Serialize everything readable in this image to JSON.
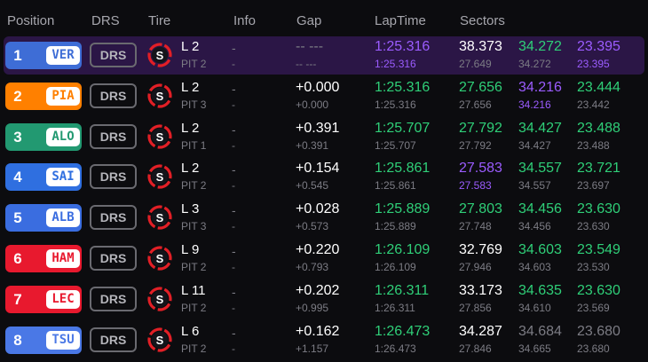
{
  "colors": {
    "purple": "#9b5cff",
    "green": "#2fcf78",
    "white": "#ffffff",
    "grey": "#7c7c84",
    "highlight_row": "#2b1646"
  },
  "header": {
    "position": "Position",
    "drs": "DRS",
    "tire": "Tire",
    "info": "Info",
    "gap": "Gap",
    "laptime": "LapTime",
    "sectors": "Sectors"
  },
  "rows": [
    {
      "pos": "1",
      "code": "VER",
      "team_color": "#3e6dd6",
      "drs": "DRS",
      "tire_icon": "soft-tire-icon",
      "tire_letter": "S",
      "lap": "L 2",
      "pit": "PIT 2",
      "info1": "-",
      "info2": "-",
      "gap": "-- ---",
      "gap_sub": "-- ---",
      "laptime": "1:25.316",
      "laptime_color": "#9b5cff",
      "laptime_sub": "1:25.316",
      "laptime_sub_color": "#9b5cff",
      "s1": "38.373",
      "s1_color": "#ffffff",
      "s1_sub": "27.649",
      "s1_sub_color": "#7c7c84",
      "s2": "34.272",
      "s2_color": "#2fcf78",
      "s2_sub": "34.272",
      "s2_sub_color": "#7c7c84",
      "s3": "23.395",
      "s3_color": "#9b5cff",
      "s3_sub": "23.395",
      "s3_sub_color": "#9b5cff",
      "highlight": true
    },
    {
      "pos": "2",
      "code": "PIA",
      "team_color": "#ff8000",
      "drs": "DRS",
      "tire_icon": "soft-tire-icon",
      "tire_letter": "S",
      "lap": "L 2",
      "pit": "PIT 3",
      "info1": "-",
      "info2": "-",
      "gap": "+0.000",
      "gap_sub": "+0.000",
      "laptime": "1:25.316",
      "laptime_color": "#2fcf78",
      "laptime_sub": "1:25.316",
      "laptime_sub_color": "#7c7c84",
      "s1": "27.656",
      "s1_color": "#2fcf78",
      "s1_sub": "27.656",
      "s1_sub_color": "#7c7c84",
      "s2": "34.216",
      "s2_color": "#9b5cff",
      "s2_sub": "34.216",
      "s2_sub_color": "#9b5cff",
      "s3": "23.444",
      "s3_color": "#2fcf78",
      "s3_sub": "23.442",
      "s3_sub_color": "#7c7c84",
      "highlight": false
    },
    {
      "pos": "3",
      "code": "ALO",
      "team_color": "#229971",
      "drs": "DRS",
      "tire_icon": "soft-tire-icon",
      "tire_letter": "S",
      "lap": "L 2",
      "pit": "PIT 1",
      "info1": "-",
      "info2": "-",
      "gap": "+0.391",
      "gap_sub": "+0.391",
      "laptime": "1:25.707",
      "laptime_color": "#2fcf78",
      "laptime_sub": "1:25.707",
      "laptime_sub_color": "#7c7c84",
      "s1": "27.792",
      "s1_color": "#2fcf78",
      "s1_sub": "27.792",
      "s1_sub_color": "#7c7c84",
      "s2": "34.427",
      "s2_color": "#2fcf78",
      "s2_sub": "34.427",
      "s2_sub_color": "#7c7c84",
      "s3": "23.488",
      "s3_color": "#2fcf78",
      "s3_sub": "23.488",
      "s3_sub_color": "#7c7c84",
      "highlight": false
    },
    {
      "pos": "4",
      "code": "SAI",
      "team_color": "#2f6fe0",
      "drs": "DRS",
      "tire_icon": "soft-tire-icon",
      "tire_letter": "S",
      "lap": "L 2",
      "pit": "PIT 2",
      "info1": "-",
      "info2": "-",
      "gap": "+0.154",
      "gap_sub": "+0.545",
      "laptime": "1:25.861",
      "laptime_color": "#2fcf78",
      "laptime_sub": "1:25.861",
      "laptime_sub_color": "#7c7c84",
      "s1": "27.583",
      "s1_color": "#9b5cff",
      "s1_sub": "27.583",
      "s1_sub_color": "#9b5cff",
      "s2": "34.557",
      "s2_color": "#2fcf78",
      "s2_sub": "34.557",
      "s2_sub_color": "#7c7c84",
      "s3": "23.721",
      "s3_color": "#2fcf78",
      "s3_sub": "23.697",
      "s3_sub_color": "#7c7c84",
      "highlight": false
    },
    {
      "pos": "5",
      "code": "ALB",
      "team_color": "#3a6de0",
      "drs": "DRS",
      "tire_icon": "soft-tire-icon",
      "tire_letter": "S",
      "lap": "L 3",
      "pit": "PIT 3",
      "info1": "-",
      "info2": "-",
      "gap": "+0.028",
      "gap_sub": "+0.573",
      "laptime": "1:25.889",
      "laptime_color": "#2fcf78",
      "laptime_sub": "1:25.889",
      "laptime_sub_color": "#7c7c84",
      "s1": "27.803",
      "s1_color": "#2fcf78",
      "s1_sub": "27.748",
      "s1_sub_color": "#7c7c84",
      "s2": "34.456",
      "s2_color": "#2fcf78",
      "s2_sub": "34.456",
      "s2_sub_color": "#7c7c84",
      "s3": "23.630",
      "s3_color": "#2fcf78",
      "s3_sub": "23.630",
      "s3_sub_color": "#7c7c84",
      "highlight": false
    },
    {
      "pos": "6",
      "code": "HAM",
      "team_color": "#e8192e",
      "drs": "DRS",
      "tire_icon": "soft-tire-icon",
      "tire_letter": "S",
      "lap": "L 9",
      "pit": "PIT 2",
      "info1": "-",
      "info2": "-",
      "gap": "+0.220",
      "gap_sub": "+0.793",
      "laptime": "1:26.109",
      "laptime_color": "#2fcf78",
      "laptime_sub": "1:26.109",
      "laptime_sub_color": "#7c7c84",
      "s1": "32.769",
      "s1_color": "#ffffff",
      "s1_sub": "27.946",
      "s1_sub_color": "#7c7c84",
      "s2": "34.603",
      "s2_color": "#2fcf78",
      "s2_sub": "34.603",
      "s2_sub_color": "#7c7c84",
      "s3": "23.549",
      "s3_color": "#2fcf78",
      "s3_sub": "23.530",
      "s3_sub_color": "#7c7c84",
      "highlight": false
    },
    {
      "pos": "7",
      "code": "LEC",
      "team_color": "#e8192e",
      "drs": "DRS",
      "tire_icon": "soft-tire-icon",
      "tire_letter": "S",
      "lap": "L 11",
      "pit": "PIT 2",
      "info1": "-",
      "info2": "-",
      "gap": "+0.202",
      "gap_sub": "+0.995",
      "laptime": "1:26.311",
      "laptime_color": "#2fcf78",
      "laptime_sub": "1:26.311",
      "laptime_sub_color": "#7c7c84",
      "s1": "33.173",
      "s1_color": "#ffffff",
      "s1_sub": "27.856",
      "s1_sub_color": "#7c7c84",
      "s2": "34.635",
      "s2_color": "#2fcf78",
      "s2_sub": "34.610",
      "s2_sub_color": "#7c7c84",
      "s3": "23.630",
      "s3_color": "#2fcf78",
      "s3_sub": "23.569",
      "s3_sub_color": "#7c7c84",
      "highlight": false
    },
    {
      "pos": "8",
      "code": "TSU",
      "team_color": "#4a78e6",
      "drs": "DRS",
      "tire_icon": "soft-tire-icon",
      "tire_letter": "S",
      "lap": "L 6",
      "pit": "PIT 2",
      "info1": "-",
      "info2": "-",
      "gap": "+0.162",
      "gap_sub": "+1.157",
      "laptime": "1:26.473",
      "laptime_color": "#2fcf78",
      "laptime_sub": "1:26.473",
      "laptime_sub_color": "#7c7c84",
      "s1": "34.287",
      "s1_color": "#ffffff",
      "s1_sub": "27.846",
      "s1_sub_color": "#7c7c84",
      "s2": "34.684",
      "s2_color": "#7c7c84",
      "s2_sub": "34.665",
      "s2_sub_color": "#7c7c84",
      "s3": "23.680",
      "s3_color": "#7c7c84",
      "s3_sub": "23.680",
      "s3_sub_color": "#7c7c84",
      "highlight": false
    }
  ]
}
